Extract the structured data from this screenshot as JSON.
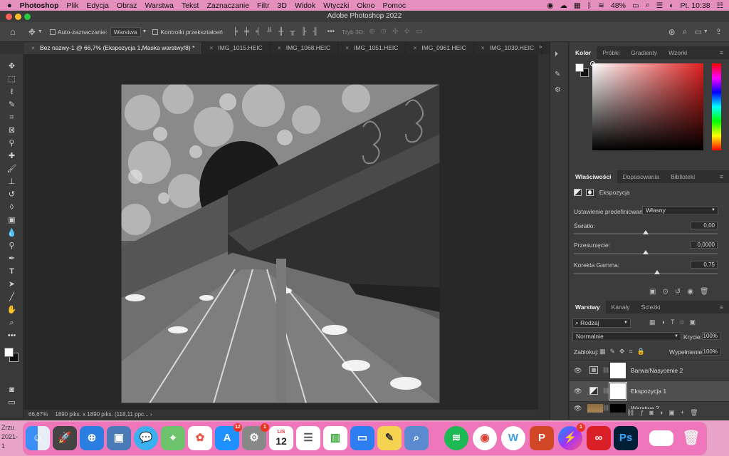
{
  "menubar": {
    "app": "Photoshop",
    "items": [
      "Plik",
      "Edycja",
      "Obraz",
      "Warstwa",
      "Tekst",
      "Zaznaczanie",
      "Filtr",
      "3D",
      "Widok",
      "Wtyczki",
      "Okno",
      "Pomoc"
    ],
    "battery": "48%",
    "clock": "Pt. 10:38"
  },
  "window": {
    "title": "Adobe Photoshop 2022"
  },
  "options": {
    "auto_select_label": "Auto-zaznaczanie:",
    "auto_select_value": "Warstwa",
    "transform_controls": "Kontrolki przekształceń",
    "mode3d": "Tryb 3D:"
  },
  "doc_tabs": [
    {
      "label": "Bez nazwy-1 @ 66,7% (Ekspozycja 1,Maska warstwy/8) *"
    },
    {
      "label": "IMG_1015.HEIC"
    },
    {
      "label": "IMG_1068.HEIC"
    },
    {
      "label": "IMG_1051.HEIC"
    },
    {
      "label": "IMG_0961.HEIC"
    },
    {
      "label": "IMG_1039.HEIC"
    },
    {
      "label": "IM"
    }
  ],
  "status": {
    "zoom": "66,67%",
    "info": "1890 piks. x 1890 piks. (118,11 ppc... ›"
  },
  "color_panel": {
    "tabs": [
      "Kolor",
      "Próbki",
      "Gradienty",
      "Wzorki"
    ]
  },
  "properties_panel": {
    "tabs": [
      "Właściwości",
      "Dopasowania",
      "Biblioteki"
    ],
    "adjustment_name": "Ekspozycja",
    "preset_label": "Ustawienie predefiniowane:",
    "preset_value": "Własny",
    "exposure_label": "Światło:",
    "exposure_value": "0,00",
    "exposure_level": 0.5,
    "offset_label": "Przesunięcie:",
    "offset_value": "0,0000",
    "offset_level": 0.5,
    "gamma_label": "Korekta Gamma:",
    "gamma_value": "0,75",
    "gamma_level": 0.58
  },
  "layers_panel": {
    "tabs": [
      "Warstwy",
      "Kanały",
      "Ścieżki"
    ],
    "filter_kind": "Rodzaj",
    "blend_mode": "Normalnie",
    "opacity_label": "Krycie:",
    "opacity_value": "100%",
    "lock_label": "Zablokuj:",
    "fill_label": "Wypełnienie:",
    "fill_value": "100%",
    "layers": [
      {
        "name": "Barwa/Nasycenie 2"
      },
      {
        "name": "Ekspozycja 1"
      },
      {
        "name": "Warstwa 2"
      }
    ]
  },
  "desktop": {
    "text_line1": "Zrzu",
    "text_line2": "2021-1"
  },
  "dock": {
    "system_prefs_badge": "1",
    "appstore_badge": "12",
    "calendar_month": "LIS",
    "calendar_day": "12",
    "messenger_badge": "1"
  },
  "colors": {
    "accent": "#e58fbf",
    "ps_dark": "#323232",
    "ps_blue": "#31a8ff"
  }
}
